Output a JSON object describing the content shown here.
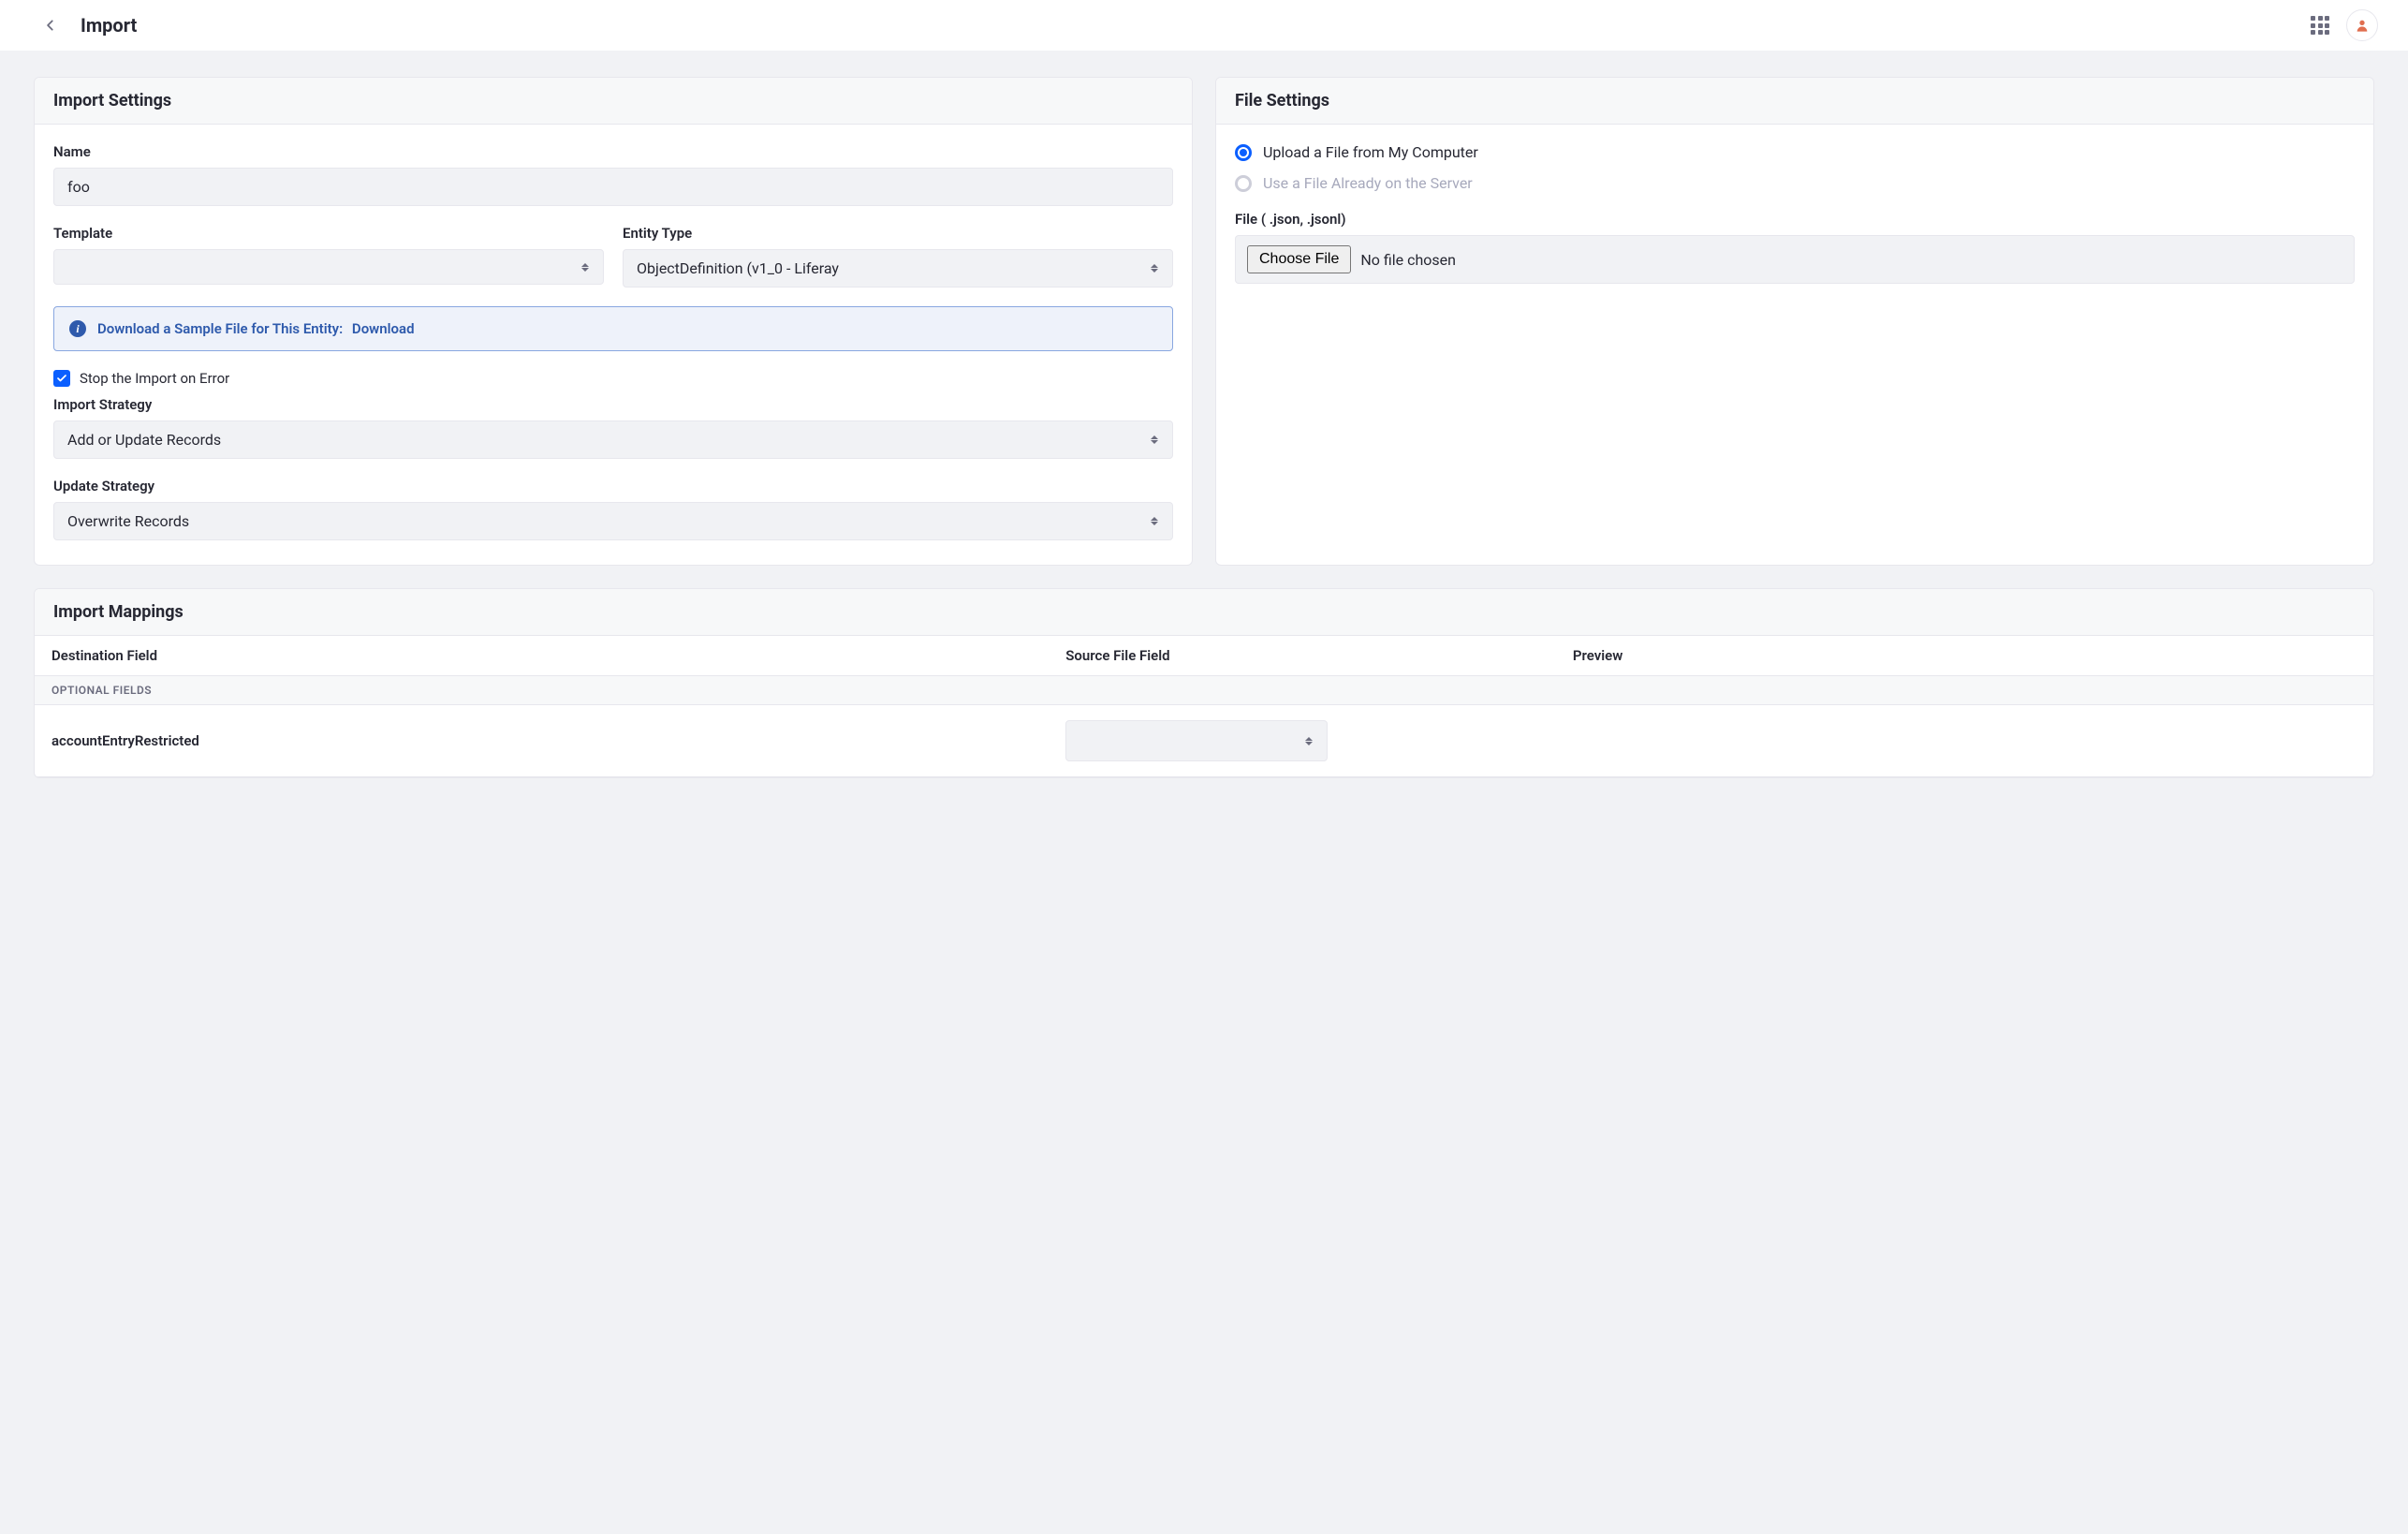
{
  "header": {
    "title": "Import"
  },
  "importSettings": {
    "title": "Import Settings",
    "nameLabel": "Name",
    "nameValue": "foo",
    "templateLabel": "Template",
    "templateValue": "",
    "entityTypeLabel": "Entity Type",
    "entityTypeValue": "ObjectDefinition (v1_0 - Liferay",
    "sampleText": "Download a Sample File for This Entity:",
    "sampleLink": "Download",
    "stopOnErrorLabel": "Stop the Import on Error",
    "stopOnErrorChecked": true,
    "importStrategyLabel": "Import Strategy",
    "importStrategyValue": "Add or Update Records",
    "updateStrategyLabel": "Update Strategy",
    "updateStrategyValue": "Overwrite Records"
  },
  "fileSettings": {
    "title": "File Settings",
    "uploadLabel": "Upload a File from My Computer",
    "serverLabel": "Use a File Already on the Server",
    "fileLabel": "File ( .json, .jsonl)",
    "chooseFile": "Choose File",
    "noFile": "No file chosen"
  },
  "mappings": {
    "title": "Import Mappings",
    "colDest": "Destination Field",
    "colSrc": "Source File Field",
    "colPrev": "Preview",
    "sectionLabel": "OPTIONAL FIELDS",
    "rows": [
      {
        "dest": "accountEntryRestricted"
      }
    ]
  }
}
